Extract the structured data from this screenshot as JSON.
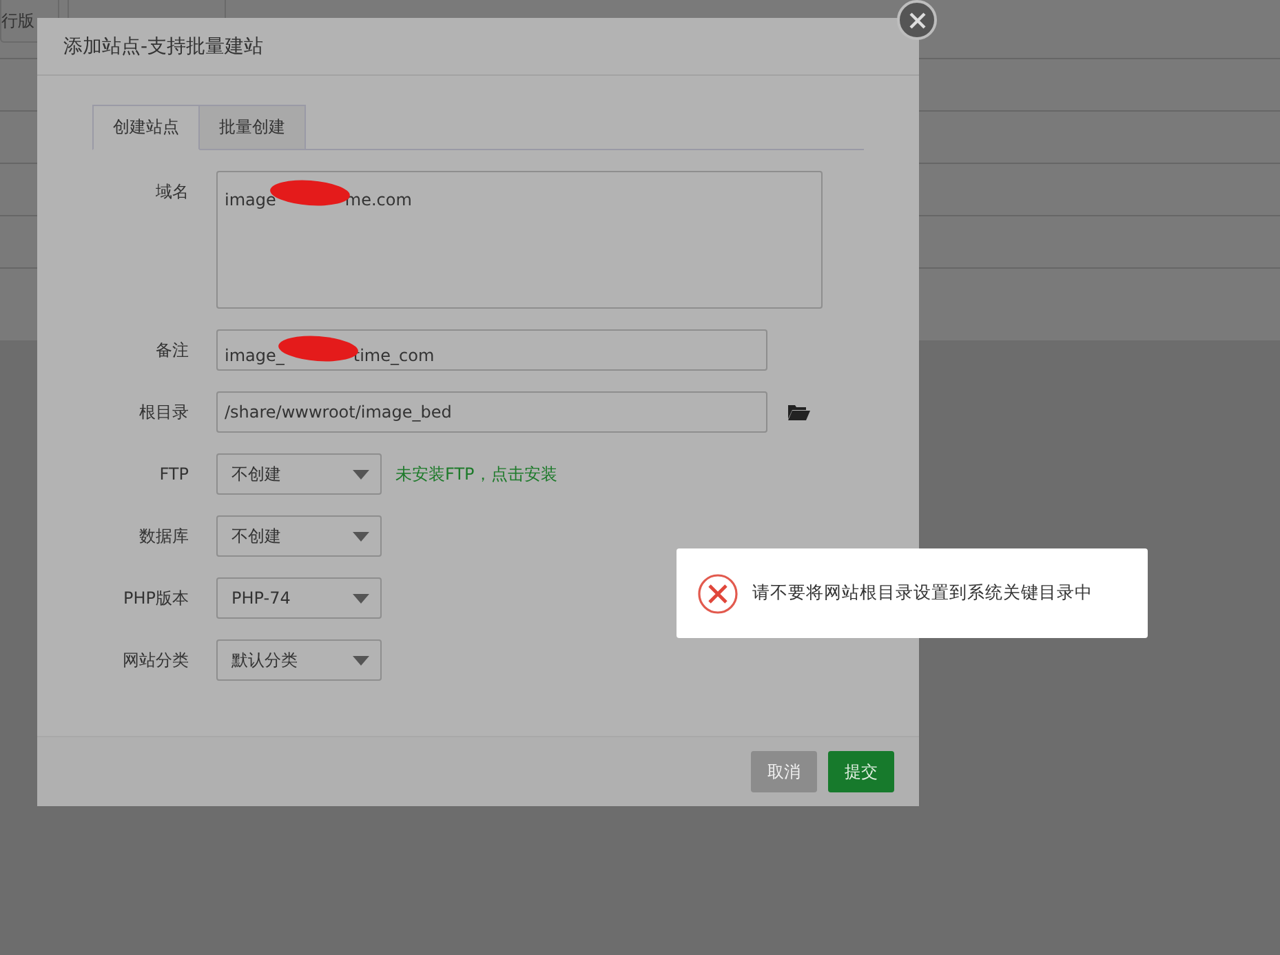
{
  "background": {
    "toolbar_buttons": [
      "行版"
    ]
  },
  "dialog": {
    "title": "添加站点-支持批量建站",
    "tabs": [
      {
        "label": "创建站点",
        "selected": true
      },
      {
        "label": "批量创建",
        "selected": false
      }
    ],
    "fields": [
      {
        "kind": "textarea",
        "label": "域名",
        "value_parts": [
          "image",
          "me.com"
        ]
      },
      {
        "kind": "text",
        "label": "备注",
        "value_parts": [
          "image_",
          "time_com"
        ]
      },
      {
        "kind": "path",
        "label": "根目录",
        "value_parts": [
          "/share/wwwroot/image_bed"
        ]
      },
      {
        "kind": "select",
        "label": "FTP",
        "value": "不创建",
        "hint": "未安装FTP，点击安装"
      },
      {
        "kind": "select",
        "label": "数据库",
        "value": "不创建"
      },
      {
        "kind": "select",
        "label": "PHP版本",
        "value": "PHP-74"
      },
      {
        "kind": "select",
        "label": "网站分类",
        "value": "默认分类"
      }
    ],
    "buttons": [
      {
        "label": "取消",
        "kind": "secondary"
      },
      {
        "label": "提交",
        "kind": "primary"
      }
    ]
  },
  "toast": {
    "message": "请不要将网站根目录设置到系统关键目录中"
  }
}
